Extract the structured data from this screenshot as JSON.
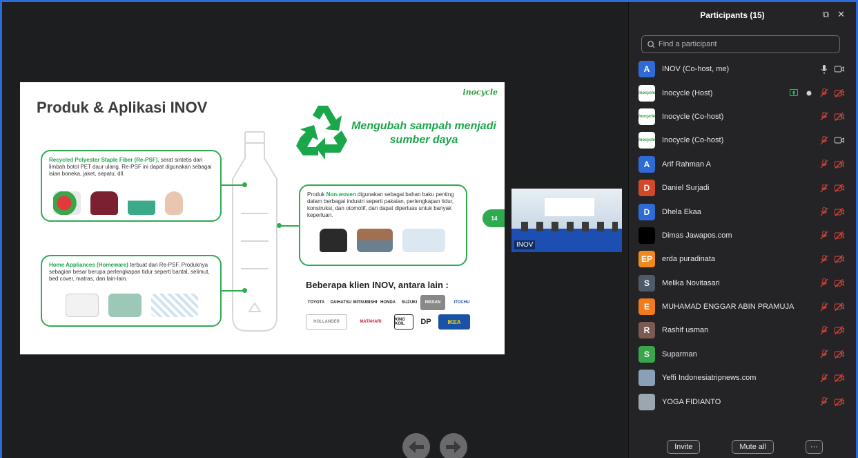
{
  "slide": {
    "title": "Produk & Aplikasi INOV",
    "logo": "inocycle",
    "slogan": "Mengubah sampah menjadi sumber daya",
    "box1": {
      "highlight": "Recycled Polyester Staple Fiber (Re-PSF)",
      "text": ", serat sintetis dari limbah botol PET daur ulang. Re-PSF ini dapat digunakan sebagai isian boneka, jaket, sepatu, dll."
    },
    "box2": {
      "prefix": "Produk ",
      "highlight": "Non-woven",
      "text": " digunakan sebagai bahan baku penting dalam berbagai industri seperti pakaian, perlengkapan tidur, konstruksi, dan otomotif, dan dapat diperluas untuk banyak keperluan."
    },
    "box3": {
      "highlight": "Home Appliances (Homeware)",
      "text": " terbuat dari Re-PSF. Produknya sebagian besar berupa perlengkapan tidur seperti bantal, selimut, bed cover, matras, dan lain-lain."
    },
    "page_number": "14",
    "clients_title": "Beberapa klien INOV, antara lain :",
    "clients": [
      "TOYOTA",
      "DAIHATSU",
      "MITSUBISHI",
      "HONDA",
      "SUZUKI",
      "NISSAN",
      "ITOCHU",
      "HOLLANDER",
      "MATAHARI",
      "KING KOIL",
      "DP",
      "IKEA"
    ]
  },
  "video_tile": {
    "name": "INOV"
  },
  "panel": {
    "title": "Participants (15)",
    "search_placeholder": "Find a participant",
    "participants": [
      {
        "name": "INOV (Co-host, me)",
        "initial": "A",
        "color": "#2f6bd6",
        "mic": "on",
        "video": "off-plain"
      },
      {
        "name": "Inocycle (Host)",
        "initial": "inocycle",
        "color": "#ffffff",
        "mic": "muted",
        "video": "muted",
        "share": true
      },
      {
        "name": "Inocycle (Co-host)",
        "initial": "inocycle",
        "color": "#ffffff",
        "mic": "muted",
        "video": "muted"
      },
      {
        "name": "Inocycle (Co-host)",
        "initial": "inocycle",
        "color": "#ffffff",
        "mic": "muted",
        "video": "off-plain"
      },
      {
        "name": "Arif Rahman A",
        "initial": "A",
        "color": "#2f6bd6",
        "mic": "muted",
        "video": "muted"
      },
      {
        "name": "Daniel Surjadi",
        "initial": "D",
        "color": "#d4482a",
        "mic": "muted",
        "video": "muted"
      },
      {
        "name": "Dhela Ekaa",
        "initial": "D",
        "color": "#2f6bd6",
        "mic": "muted",
        "video": "muted"
      },
      {
        "name": "Dimas Jawapos.com",
        "initial": "",
        "color": "#000000",
        "mic": "muted",
        "video": "muted"
      },
      {
        "name": "erda puradinata",
        "initial": "EP",
        "color": "#f08a1c",
        "mic": "muted",
        "video": "muted"
      },
      {
        "name": "Melika Novitasari",
        "initial": "S",
        "color": "#4d5a6a",
        "mic": "muted",
        "video": "muted"
      },
      {
        "name": "MUHAMAD ENGGAR ABIN PRAMUJA",
        "initial": "E",
        "color": "#f07a1c",
        "mic": "muted",
        "video": "muted"
      },
      {
        "name": "Rashif usman",
        "initial": "R",
        "color": "#7a5a52",
        "mic": "muted",
        "video": "muted"
      },
      {
        "name": "Suparman",
        "initial": "S",
        "color": "#3aa64a",
        "mic": "muted",
        "video": "muted"
      },
      {
        "name": "Yeffi Indonesiatripnews.com",
        "initial": "",
        "color": "#8aa0b8",
        "mic": "muted",
        "video": "muted"
      },
      {
        "name": "YOGA FIDIANTO",
        "initial": "",
        "color": "#9aa6b0",
        "mic": "muted",
        "video": "muted"
      }
    ],
    "invite_label": "Invite",
    "mute_all_label": "Mute all",
    "more_label": "···"
  }
}
